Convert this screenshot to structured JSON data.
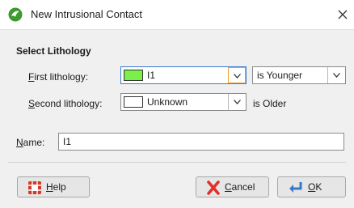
{
  "window": {
    "title": "New Intrusional Contact",
    "close_glyph": "✕"
  },
  "section": {
    "title": "Select Lithology"
  },
  "first_lithology": {
    "label_accel": "F",
    "label_rest": "irst lithology:",
    "value": "I1",
    "swatch_color": "#7cf04a",
    "relation_value": "is Younger"
  },
  "second_lithology": {
    "label_accel": "S",
    "label_rest": "econd lithology:",
    "value": "Unknown",
    "swatch_color": "#ffffff",
    "relation_text": "is Older"
  },
  "name_field": {
    "label_accel": "N",
    "label_rest": "ame:",
    "value": "I1"
  },
  "buttons": {
    "help_accel": "H",
    "help_rest": "elp",
    "cancel_accel": "C",
    "cancel_rest": "ancel",
    "ok_accel": "O",
    "ok_rest": "K"
  },
  "icons": {
    "app": "leapfrog-app-icon",
    "help": "lifebuoy-icon",
    "cancel": "red-x-icon",
    "ok": "enter-arrow-icon"
  }
}
